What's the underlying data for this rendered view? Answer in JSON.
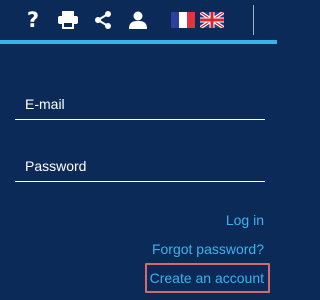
{
  "toolbar": {
    "icons": [
      "question-mark-icon",
      "printer-icon",
      "share-icon",
      "user-icon"
    ],
    "help_glyph": "?",
    "languages": [
      "french-flag",
      "uk-flag"
    ]
  },
  "colors": {
    "background": "#0b2a57",
    "accent": "#39b3ef",
    "link": "#39b3ef",
    "highlight_border": "#d56a6a",
    "text": "#ffffff"
  },
  "form": {
    "email_placeholder": "E-mail",
    "password_placeholder": "Password"
  },
  "links": {
    "login": "Log in",
    "forgot_password": "Forgot password?",
    "create_account": "Create an account"
  }
}
